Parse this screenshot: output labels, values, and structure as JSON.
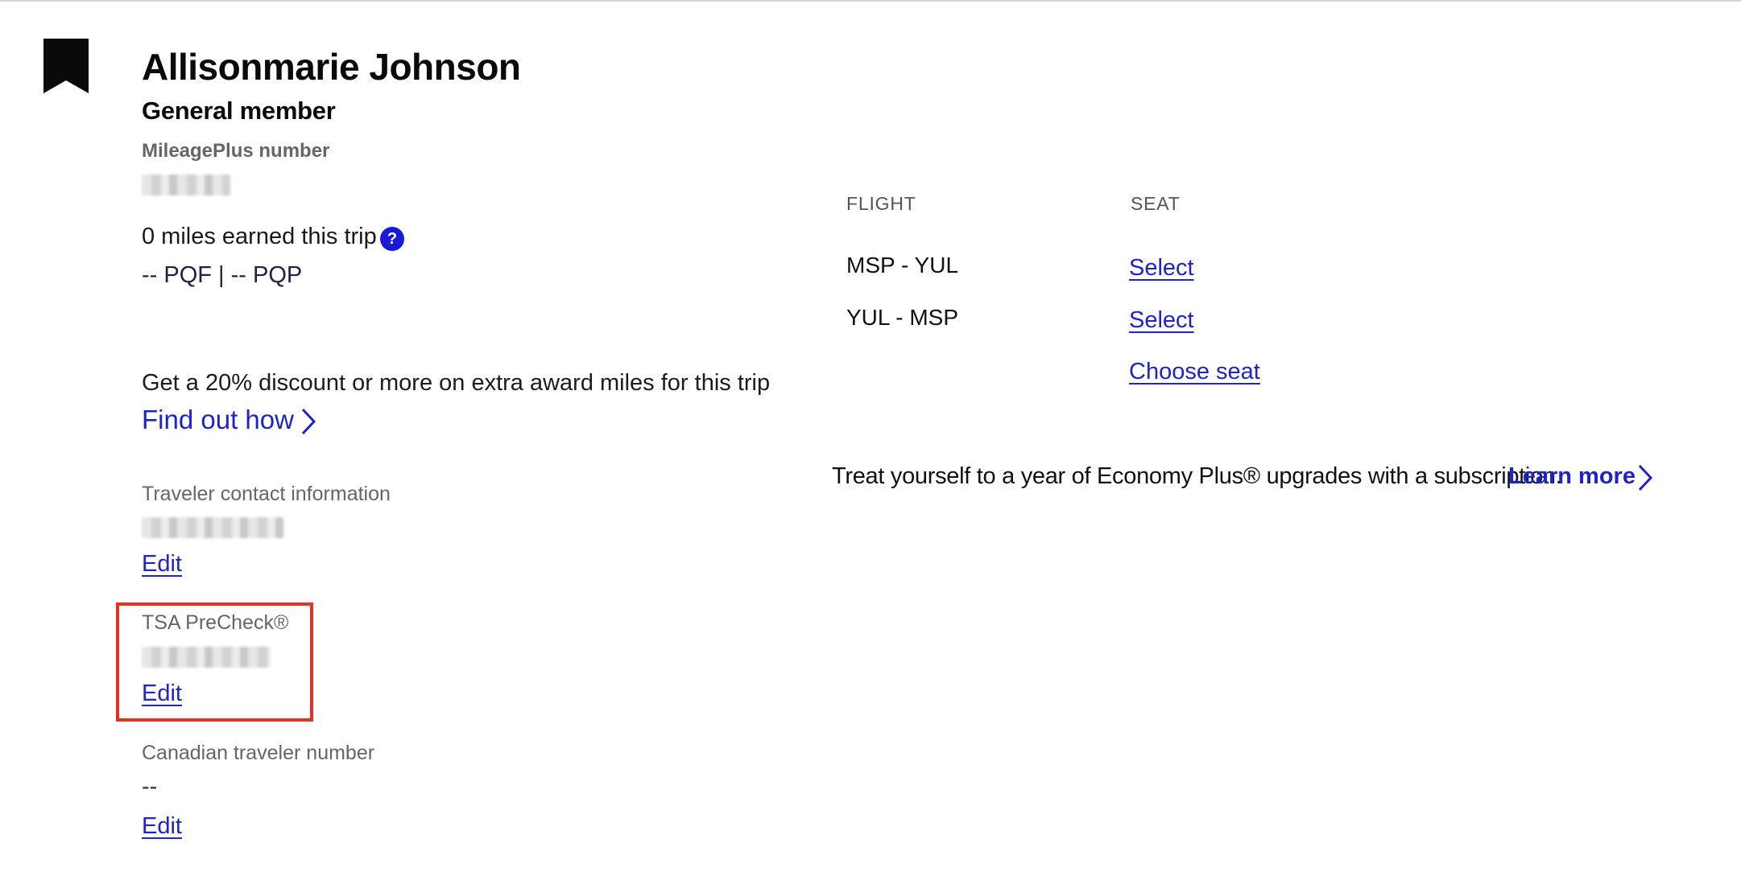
{
  "traveler": {
    "name": "Allisonmarie Johnson",
    "tier": "General member",
    "mileageplus_label": "MileagePlus number",
    "miles_earned": "0 miles earned this trip",
    "pq_summary": "-- PQF | -- PQP",
    "help_glyph": "?"
  },
  "promo": {
    "text": "Get a 20% discount or more on extra award miles for this trip",
    "link": "Find out how"
  },
  "contact": {
    "label": "Traveler contact information",
    "edit": "Edit"
  },
  "tsa": {
    "label": "TSA PreCheck®",
    "edit": "Edit"
  },
  "canadian": {
    "label": "Canadian traveler number",
    "value": "--",
    "edit": "Edit"
  },
  "flights": {
    "flight_header": "FLIGHT",
    "seat_header": "SEAT",
    "rows": [
      {
        "route": "MSP - YUL",
        "seat_action": "Select"
      },
      {
        "route": "YUL - MSP",
        "seat_action": "Select"
      }
    ],
    "choose_seat": "Choose seat"
  },
  "upsell": {
    "text": "Treat yourself to a year of Economy Plus® upgrades with a subscription.",
    "link": "Learn more"
  },
  "colors": {
    "link": "#1f24c8",
    "help_icon": "#1a1ad6",
    "highlight_border": "#e53121"
  },
  "icons": [
    "bookmark-icon",
    "help-icon",
    "chevron-right-icon"
  ]
}
